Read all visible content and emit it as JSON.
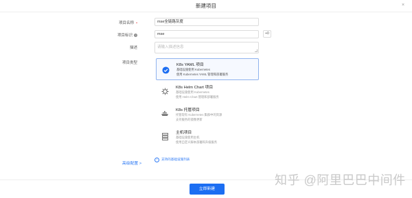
{
  "modal": {
    "title": "新建项目",
    "close_icon": "×",
    "submit_label": "立即新建"
  },
  "form": {
    "name": {
      "label": "项目名称",
      "value": "mse全链路灰度"
    },
    "identifier": {
      "label": "项目标识",
      "value": "mse",
      "regen_label": "+0"
    },
    "description": {
      "label": "描述",
      "placeholder": "请输入描述信息"
    },
    "type": {
      "label": "项目类型",
      "options": [
        {
          "title": "K8s YAML 项目",
          "desc1": "基础设施使用 Kubernetes",
          "desc2": "使用 Kubernetes YAML 管理和部署服务",
          "icon": "check-circle-icon",
          "selected": true
        },
        {
          "title": "K8s Helm Chart 项目",
          "desc1": "基础设施使用 Kubernetes",
          "desc2": "使用 Helm Chart 管理和部署服务",
          "icon": "helm-icon",
          "selected": false
        },
        {
          "title": "K8s 托管项目",
          "desc1": "托管现有 Kubernetes 集群中的资源",
          "desc2": "支持服务的镜像更新",
          "icon": "k8s-hosted-icon",
          "selected": false
        },
        {
          "title": "主机项目",
          "desc1": "基础设施使用主机",
          "desc2": "使用自定义脚本部署和升级服务",
          "icon": "server-icon",
          "selected": false
        }
      ],
      "supported_link": "支持的基础设施列表"
    },
    "advanced": "高级配置 >"
  },
  "watermark": "知乎 @阿里巴巴中间件",
  "colors": {
    "primary": "#1c6ef2",
    "selected_border": "#8fb3ee",
    "required": "#e54545"
  }
}
